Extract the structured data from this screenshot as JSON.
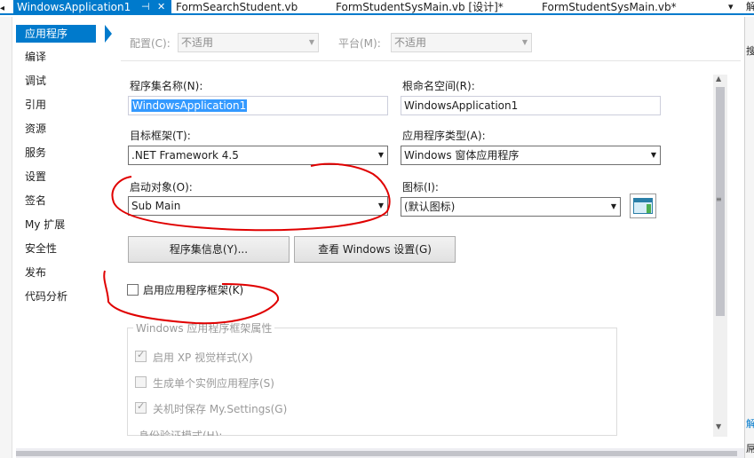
{
  "tabs": [
    {
      "label": "WindowsApplication1",
      "active": true
    },
    {
      "label": "FormSearchStudent.vb"
    },
    {
      "label": "FormStudentSysMain.vb [设计]*"
    },
    {
      "label": "FormStudentSysMain.vb*"
    }
  ],
  "tab_icons": {
    "pin": "⊣",
    "close": "✕",
    "overflow": "▾"
  },
  "nav": {
    "items": [
      "应用程序",
      "编译",
      "调试",
      "引用",
      "资源",
      "服务",
      "设置",
      "签名",
      "My 扩展",
      "安全性",
      "发布",
      "代码分析"
    ],
    "selected": 0
  },
  "config": {
    "config_label": "配置(C):",
    "config_value": "不适用",
    "platform_label": "平台(M):",
    "platform_value": "不适用"
  },
  "form": {
    "assembly_label": "程序集名称(N):",
    "assembly_value": "WindowsApplication1",
    "namespace_label": "根命名空间(R):",
    "namespace_value": "WindowsApplication1",
    "target_label": "目标框架(T):",
    "target_value": ".NET Framework 4.5",
    "apptype_label": "应用程序类型(A):",
    "apptype_value": "Windows 窗体应用程序",
    "startup_label": "启动对象(O):",
    "startup_value": "Sub Main",
    "icon_label": "图标(I):",
    "icon_value": "(默认图标)",
    "assembly_info_button": "程序集信息(Y)...",
    "windows_settings_button": "查看 Windows 设置(G)",
    "enable_framework_label": "启用应用程序框架(K)",
    "enable_framework_checked": false
  },
  "group": {
    "title": "Windows 应用程序框架属性",
    "xp_label": "启用 XP 视觉样式(X)",
    "xp_checked": true,
    "single_label": "生成单个实例应用程序(S)",
    "single_checked": false,
    "save_label": "关机时保存 My.Settings(G)",
    "save_checked": true,
    "auth_label": "身份验证模式(H):"
  },
  "right_panel": {
    "chars": [
      "解",
      "搜",
      "解",
      "屌"
    ]
  },
  "colors": {
    "accent": "#007acc",
    "annotation": "#e00000"
  }
}
